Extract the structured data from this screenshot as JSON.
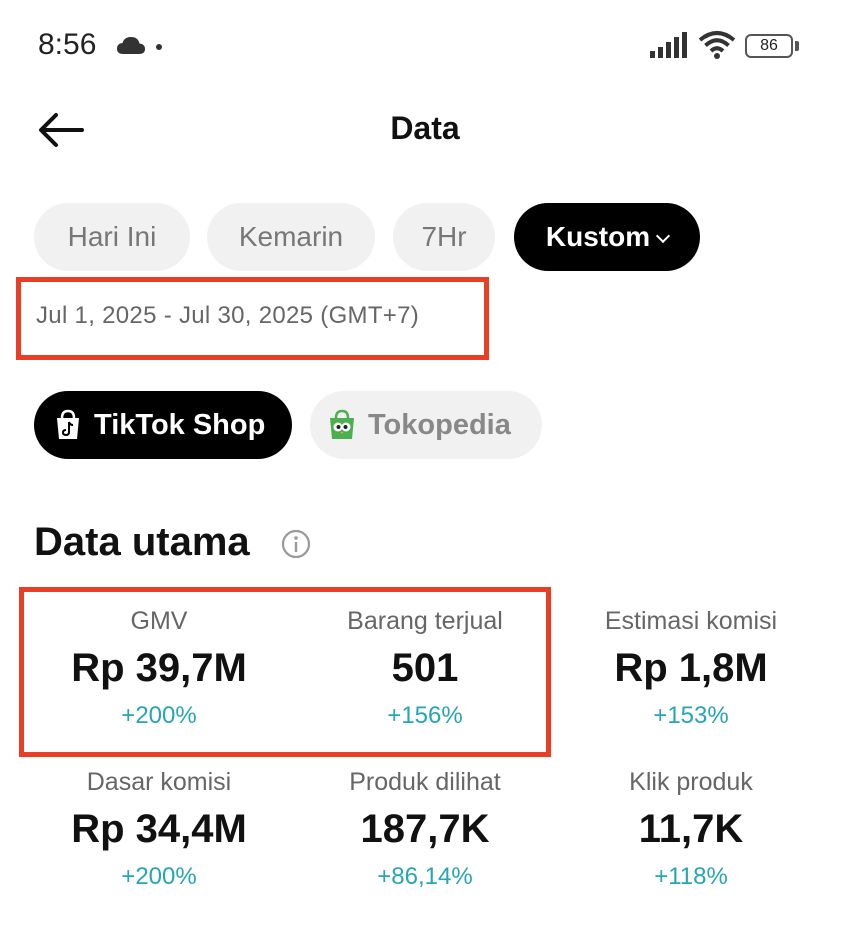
{
  "status_bar": {
    "time": "8:56",
    "battery": "86",
    "icons": [
      "cloud-icon",
      "signal-icon",
      "wifi-icon",
      "battery-icon"
    ]
  },
  "header": {
    "title": "Data",
    "back_icon": "arrow-left-icon"
  },
  "date_filters": [
    {
      "label": "Hari Ini",
      "active": false
    },
    {
      "label": "Kemarin",
      "active": false
    },
    {
      "label": "7Hr",
      "active": false
    },
    {
      "label": "Kustom",
      "active": true
    }
  ],
  "date_range": "Jul 1, 2025 - Jul 30, 2025 (GMT+7)",
  "platforms": [
    {
      "label": "TikTok Shop",
      "active": true,
      "icon": "tiktok-shop-icon"
    },
    {
      "label": "Tokopedia",
      "active": false,
      "icon": "tokopedia-icon"
    }
  ],
  "section": {
    "title": "Data utama",
    "info_icon": "info-icon"
  },
  "metrics": [
    {
      "label": "GMV",
      "value": "Rp 39,7M",
      "change": "+200%"
    },
    {
      "label": "Barang terjual",
      "value": "501",
      "change": "+156%"
    },
    {
      "label": "Estimasi komisi",
      "value": "Rp 1,8M",
      "change": "+153%"
    },
    {
      "label": "Dasar komisi",
      "value": "Rp 34,4M",
      "change": "+200%"
    },
    {
      "label": "Produk dilihat",
      "value": "187,7K",
      "change": "+86,14%"
    },
    {
      "label": "Klik produk",
      "value": "11,7K",
      "change": "+118%"
    }
  ],
  "colors": {
    "accent_change": "#26a6b2",
    "highlight": "#ea3d25",
    "active_chip": "#000000",
    "inactive_chip": "#f1f1f1"
  }
}
